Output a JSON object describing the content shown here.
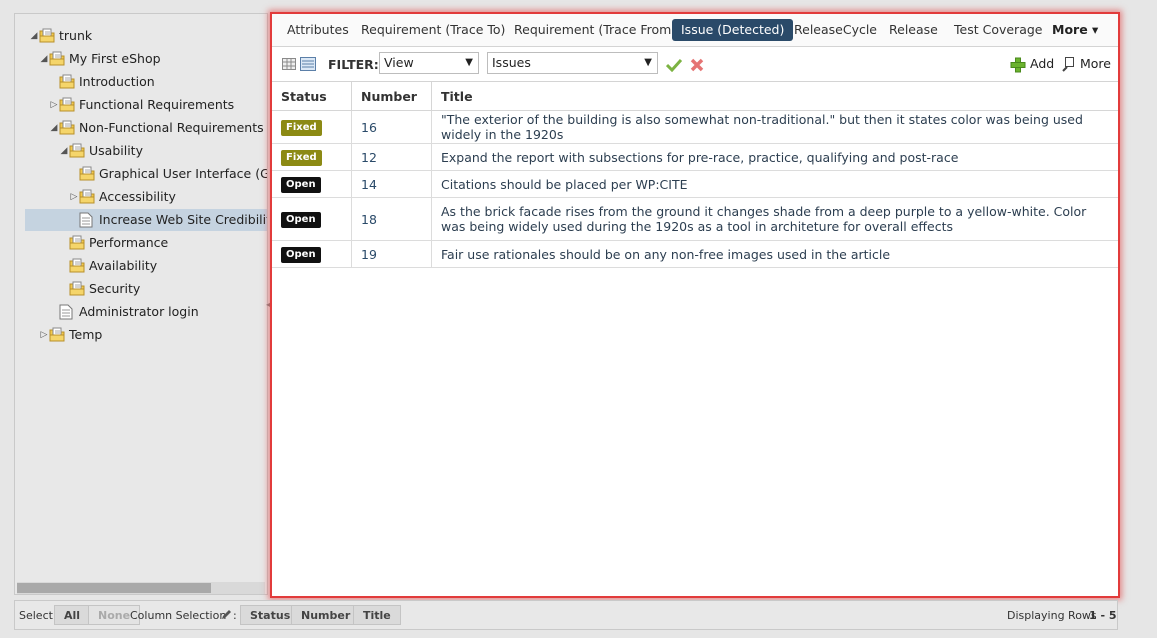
{
  "tree": {
    "items": [
      {
        "label": "trunk",
        "expander": "◢",
        "icon": "folder-doc"
      },
      {
        "label": "My First eShop",
        "expander": "◢",
        "icon": "folder-doc"
      },
      {
        "label": "Introduction",
        "expander": "",
        "icon": "folder-doc"
      },
      {
        "label": "Functional Requirements",
        "expander": "▷",
        "icon": "folder-doc"
      },
      {
        "label": "Non-Functional Requirements",
        "expander": "◢",
        "icon": "folder-doc"
      },
      {
        "label": "Usability",
        "expander": "◢",
        "icon": "folder-doc"
      },
      {
        "label": "Graphical User Interface (GUI)",
        "expander": "",
        "icon": "folder-doc"
      },
      {
        "label": "Accessibility",
        "expander": "▷",
        "icon": "folder-doc"
      },
      {
        "label": "Increase Web Site Credibility",
        "expander": "",
        "icon": "document"
      },
      {
        "label": "Performance",
        "expander": "",
        "icon": "folder-doc"
      },
      {
        "label": "Availability",
        "expander": "",
        "icon": "folder-doc"
      },
      {
        "label": "Security",
        "expander": "",
        "icon": "folder-doc"
      },
      {
        "label": "Administrator login",
        "expander": "",
        "icon": "document"
      },
      {
        "label": "Temp",
        "expander": "▷",
        "icon": "folder-doc"
      }
    ]
  },
  "tabs": {
    "attributes": "Attributes",
    "trace_to": "Requirement (Trace To)",
    "trace_from": "Requirement (Trace From)",
    "issue_detected": "Issue (Detected)",
    "release_cycle": "ReleaseCycle",
    "release": "Release",
    "test_coverage": "Test Coverage",
    "more": "More ▾"
  },
  "toolbar": {
    "filter_label": "FILTER:",
    "view_select": "View",
    "type_select": "Issues",
    "add_label": "Add",
    "more_label": "More"
  },
  "grid": {
    "headers": {
      "status": "Status",
      "number": "Number",
      "title": "Title"
    },
    "rows": [
      {
        "status": "Fixed",
        "number": "16",
        "title": "\"The exterior of the building is also somewhat non-traditional.\" but then it states color was being used widely in the 1920s"
      },
      {
        "status": "Fixed",
        "number": "12",
        "title": "Expand the report with subsections for pre-race, practice, qualifying and post-race"
      },
      {
        "status": "Open",
        "number": "14",
        "title": "Citations should be placed per WP:CITE"
      },
      {
        "status": "Open",
        "number": "18",
        "title": "As the brick facade rises from the ground it changes shade from a deep purple to a yellow-white. Color was being widely used during the 1920s as a tool in architeture for overall effects"
      },
      {
        "status": "Open",
        "number": "19",
        "title": "Fair use rationales should be on any non-free images used in the article"
      }
    ]
  },
  "status_colors": {
    "Fixed": "#8c8a14",
    "Open": "#111111"
  },
  "bottom": {
    "select_label": "Select",
    "all": "All",
    "none": "None",
    "column_selection": "Column Selection",
    "col_status": "Status",
    "col_number": "Number",
    "col_title": "Title",
    "displaying": "Displaying Rows",
    "range": "1 - 5"
  }
}
